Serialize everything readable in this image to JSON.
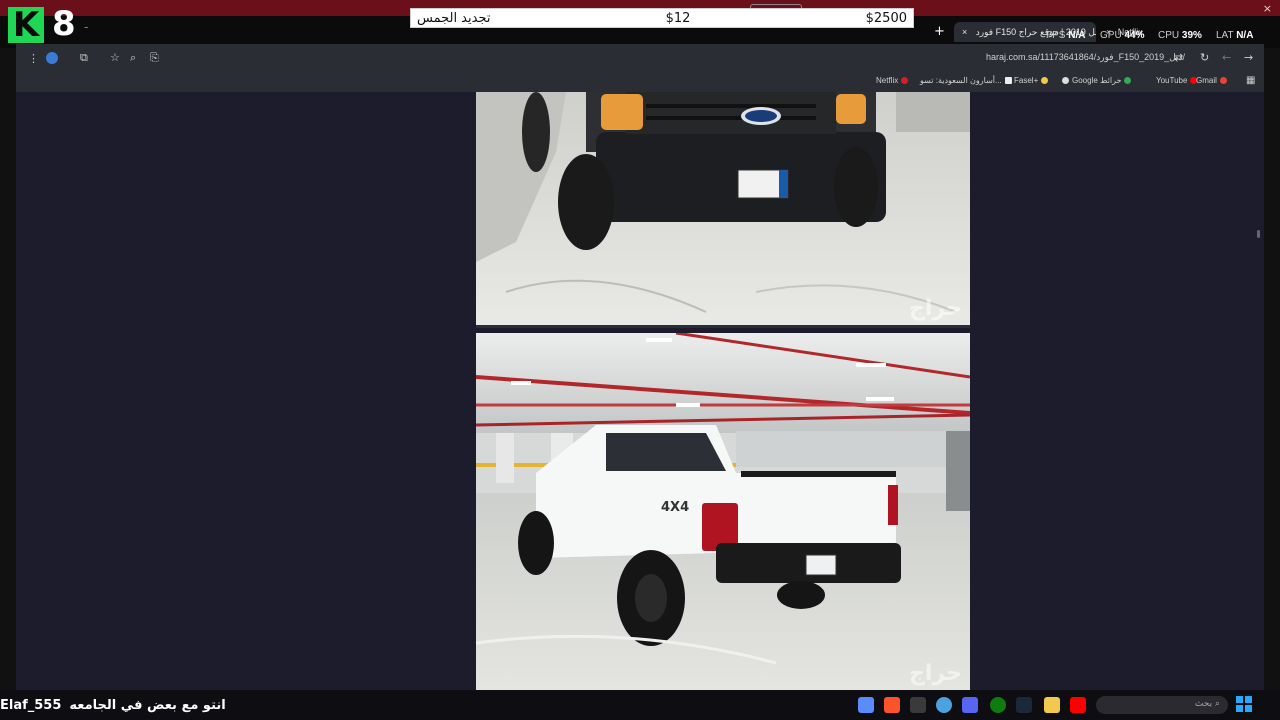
{
  "overlay": {
    "logo_letter": "K",
    "logo_number": "8",
    "dash": "-",
    "goal": {
      "name": "تجديد الجمس",
      "amount": "$12",
      "target": "$2500"
    },
    "close": "×"
  },
  "perf": {
    "fps_label": "FPS",
    "fps_value": "N/A",
    "gpu_label": "GPU",
    "gpu_value": "44%",
    "cpu_label": "CPU",
    "cpu_value": "39%",
    "lat_label": "LAT",
    "lat_value": "N/A"
  },
  "browser": {
    "tabs": [
      {
        "title": "فورد F150 دبل 2019 | موقع حراج",
        "active": true
      },
      {
        "title": "Netflix",
        "active": false
      }
    ],
    "tab_close": "×",
    "new_tab": "+",
    "url": "haraj.com.sa/11173641864/فورد_F150_2019_دبل/",
    "bookmarks": [
      "Netflix",
      "أسارون السعودية: تسو...",
      "Fasel+",
      "Google خرائط",
      "YouTube",
      "Gmail"
    ]
  },
  "page": {
    "watermark": "حراج"
  },
  "taskbar": {
    "chat_text": "انتو مع بعض في الجامعه",
    "chat_user": "Elaf_555",
    "search_placeholder": "بحث"
  },
  "colors": {
    "accent_green": "#1fd655",
    "overlay_red": "#6b0f1a",
    "page_bg": "#1c1c2c",
    "chrome_bg": "#2a2d33"
  }
}
